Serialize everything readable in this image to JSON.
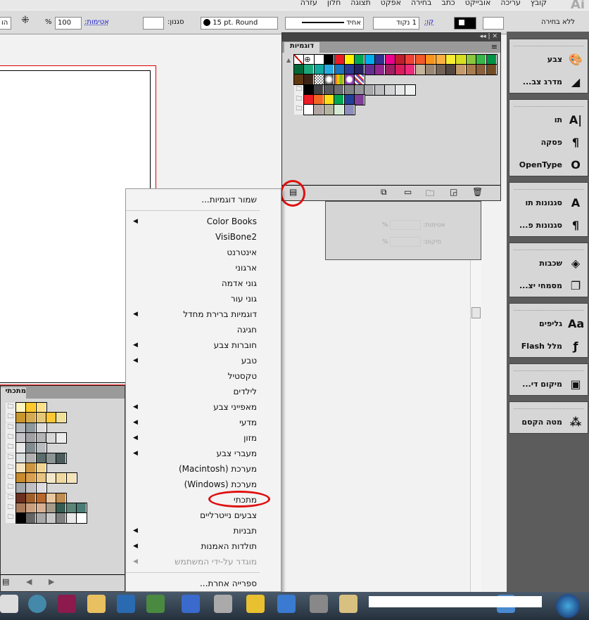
{
  "menubar": [
    "קובץ",
    "עריכה",
    "אובייקט",
    "כתב",
    "בחירה",
    "אפקט",
    "תצוגה",
    "חלון",
    "עזרה"
  ],
  "app_logo": "Ai",
  "control": {
    "selection": "ללא בחירה",
    "stroke_label": "קו:",
    "stroke_weight": "1 נקוד",
    "stroke_profile": "אחיד",
    "brush": "15 pt. Round",
    "style_label": "סגנון:",
    "opacity_label": "אטימות:",
    "opacity_value": "100",
    "percent": "%",
    "cut_button": "הו"
  },
  "dock": {
    "groups": [
      [
        {
          "label": "צבע",
          "icon": "palette-icon",
          "glyph": "🎨"
        },
        {
          "label": "...מדרג צב",
          "icon": "gradient-icon",
          "glyph": "◢"
        }
      ],
      [
        {
          "label": "תו",
          "icon": "character-icon",
          "glyph": "A|"
        },
        {
          "label": "פסקה",
          "icon": "paragraph-icon",
          "glyph": "¶"
        },
        {
          "label": "OpenType",
          "icon": "opentype-icon",
          "glyph": "O"
        }
      ],
      [
        {
          "label": "סגנונות תו",
          "icon": "char-styles-icon",
          "glyph": "A"
        },
        {
          "label": "...סגנונות פ",
          "icon": "para-styles-icon",
          "glyph": "¶"
        }
      ],
      [
        {
          "label": "שכבות",
          "icon": "layers-icon",
          "glyph": "◈"
        },
        {
          "label": "...מסמחי יצ",
          "icon": "artboards-icon",
          "glyph": "❐"
        }
      ],
      [
        {
          "label": "גליפים",
          "icon": "glyphs-icon",
          "glyph": "Aa"
        },
        {
          "label": "Flash מלל",
          "icon": "flash-icon",
          "glyph": "ƒ"
        }
      ],
      [
        {
          "label": "...מיקום די",
          "icon": "links-icon",
          "glyph": "▣"
        }
      ],
      [
        {
          "label": "מטה הקסם",
          "icon": "magic-wand-icon",
          "glyph": "⁂"
        }
      ]
    ]
  },
  "swatches": {
    "tab": "דוגמיות",
    "rows": [
      [
        "none",
        "reg",
        "#ffffff",
        "#000000",
        "#ed1c24",
        "#fff200",
        "#00a651",
        "#00aeef",
        "#2e3192",
        "#ec008c",
        "#be1e2d",
        "#ef4136",
        "#f15a29",
        "#f7941d",
        "#fbb040",
        "#f9ed32",
        "#d7df23",
        "#8dc63f",
        "#39b54a",
        "#009444"
      ],
      [
        "#006838",
        "#1ba77a",
        "#12a89d",
        "#27aae1",
        "#1c75bc",
        "#2b3990",
        "#262262",
        "#662d91",
        "#92278f",
        "#9e1f63",
        "#da1c5c",
        "#ee2a7b",
        "#c2b59b",
        "#998675",
        "#736357",
        "#534741",
        "#c49a6c",
        "#a97c50",
        "#8b5e3c",
        "#754c24"
      ],
      [
        "#603913",
        "#3c2415",
        "pattern1",
        "pattern2",
        "pattern3",
        "pattern4",
        "pattern5"
      ]
    ],
    "groups": [
      [
        "#000000",
        "#414042",
        "#58595b",
        "#6d6e71",
        "#808285",
        "#939598",
        "#a7a9ac",
        "#bcbec0",
        "#d1d3d4",
        "#e6e7e8",
        "#f1f2f2"
      ],
      [
        "#ed1c24",
        "#f26522",
        "#ffde17",
        "#00a651",
        "#21409a",
        "#7f3f98"
      ],
      [
        "#ffffff",
        "#b3a6a4",
        "#b4b4a0",
        "#d5ead5",
        "#8e8ebc"
      ]
    ]
  },
  "transparency": {
    "opacity_label": "אטימות:",
    "position_label": "מיקום:",
    "percent": "%"
  },
  "library_menu": {
    "items": [
      {
        "label": "שמור דוגמיות...",
        "arrow": false
      },
      {
        "sep": true
      },
      {
        "label": "Color Books",
        "arrow": true
      },
      {
        "label": "VisiBone2",
        "arrow": false
      },
      {
        "label": "אינטרנט",
        "arrow": false
      },
      {
        "label": "ארגוני",
        "arrow": false
      },
      {
        "label": "גוני אדמה",
        "arrow": false
      },
      {
        "label": "גוני עור",
        "arrow": false
      },
      {
        "label": "דוגמיות ברירת מחדל",
        "arrow": true
      },
      {
        "label": "חגיגה",
        "arrow": false
      },
      {
        "label": "חוברות צבע",
        "arrow": true
      },
      {
        "label": "טבע",
        "arrow": true
      },
      {
        "label": "טקסטיל",
        "arrow": false
      },
      {
        "label": "לילדים",
        "arrow": false
      },
      {
        "label": "מאפייני צבע",
        "arrow": true
      },
      {
        "label": "מדעי",
        "arrow": true
      },
      {
        "label": "מזון",
        "arrow": true
      },
      {
        "label": "מעברי צבע",
        "arrow": true
      },
      {
        "label": "מערכת (Macintosh)",
        "arrow": false
      },
      {
        "label": "מערכת (Windows)",
        "arrow": false
      },
      {
        "label": "מתכתי",
        "arrow": false
      },
      {
        "label": "צבעים נייטרליים",
        "arrow": false
      },
      {
        "label": "תבניות",
        "arrow": true
      },
      {
        "label": "תולדות האמנות",
        "arrow": true
      },
      {
        "label": "מוגדר על-ידי המשתמש",
        "arrow": true,
        "disabled": true
      },
      {
        "sep": true
      },
      {
        "label": "ספרייה אחרת...",
        "arrow": false
      }
    ]
  },
  "metallic_panel": {
    "tab": "מתכתי",
    "groups": [
      [
        "#fff5c0",
        "#ffc82c",
        "#fde08c"
      ],
      [
        "#c8962c",
        "#d4aa50",
        "#e4c878",
        "#ffc832",
        "#f0e09c"
      ],
      [
        "#b4b8bc",
        "#8c989c",
        "#dcdcdc"
      ],
      [
        "#c4c4c8",
        "#a0a0a4",
        "#b4b4b8",
        "#d8d8d8",
        "#ececec"
      ],
      [
        "#e8e8e8",
        "#808c90",
        "#b8bcc0"
      ],
      [
        "#d8dcdc",
        "#b0b0b0",
        "#5a6c6c",
        "#8c9494",
        "#4c5c5c"
      ],
      [
        "#f4e4c0",
        "#cc9640",
        "#f0d490"
      ],
      [
        "#c88c2c",
        "#d8a050",
        "#e8c480",
        "#f4e8cc",
        "#f0d8a0",
        "#f4e4b8"
      ],
      [
        "#a4a8ac",
        "#c0c0c4",
        "#dcdce0"
      ],
      [
        "#6c3020",
        "#a0602c",
        "#b8682c",
        "#e8c8a0",
        "#c08c50"
      ],
      [
        "#a87c5c",
        "#c8a080",
        "#d8b094",
        "#a49c88",
        "#345c50",
        "#5c8478",
        "#487c74"
      ],
      [
        "#000000",
        "#646464",
        "#a8a8a8",
        "#c8c8c8",
        "#808080",
        "#e8e8e8",
        "#ffffff"
      ]
    ]
  }
}
